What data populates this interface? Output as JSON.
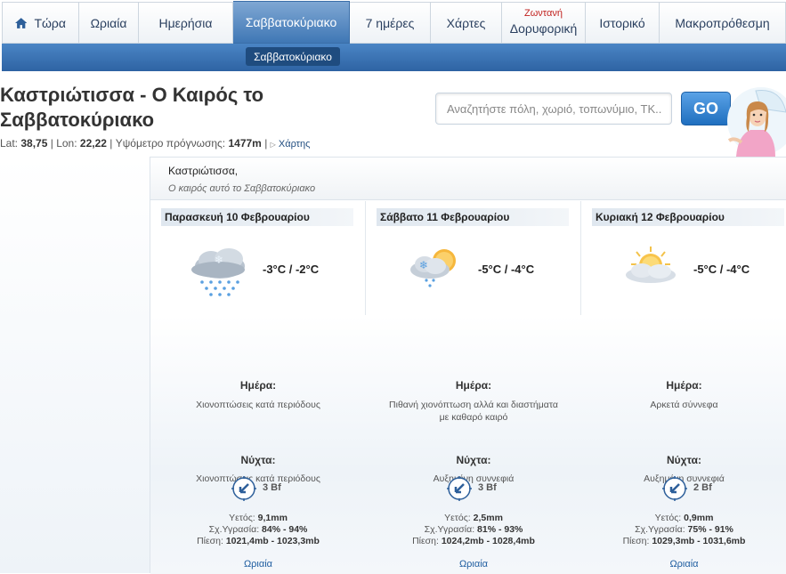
{
  "nav": {
    "tabs": [
      {
        "label": "Τώρα",
        "icon": "home-icon"
      },
      {
        "label": "Ωριαία"
      },
      {
        "label": "Ημερήσια"
      },
      {
        "label": "Σαββατοκύριακο",
        "active": true
      },
      {
        "label": "7 ημέρες"
      },
      {
        "label": "Χάρτες"
      },
      {
        "label": "Δορυφορική",
        "badge": "Ζωντανή"
      },
      {
        "label": "Ιστορικό"
      },
      {
        "label": "Μακροπρόθεσμη"
      }
    ],
    "subnav_active": "Σαββατοκύριακο"
  },
  "page": {
    "title": "Καστριώτισσα - Ο Καιρός το Σαββατοκύριακο",
    "lat_label": "Lat:",
    "lat": "38,75",
    "lon_label": "Lon:",
    "lon": "22,22",
    "elev_label": "Υψόμετρο πρόγνωσης:",
    "elev": "1477m",
    "map_link": "Χάρτης"
  },
  "search": {
    "placeholder": "Αναζητήστε πόλη, χωριό, τοπωνύμιο, ΤΚ..",
    "go_label": "GO"
  },
  "forecast": {
    "location": "Καστριώτισσα,",
    "subtitle": "Ο καιρός αυτό το Σαββατοκύριακο",
    "day_label": "Ημέρα:",
    "night_label": "Νύχτα:",
    "rain_label": "Υετός:",
    "humidity_label": "Σχ.Υγρασία:",
    "pressure_label": "Πίεση:",
    "hourly_link": "Ωριαία",
    "days": [
      {
        "title": "Παρασκευή 10 Φεβρουαρίου",
        "icon": "snow-cloud-icon",
        "temp": "-3°C / -2°C",
        "day_text": "Χιονοπτώσεις κατά περιόδους",
        "night_text": "Χιονοπτώσεις κατά περιόδους",
        "wind": "3 Bf",
        "rain": "9,1mm",
        "humidity": "84% - 94%",
        "pressure": "1021,4mb - 1023,3mb"
      },
      {
        "title": "Σάββατο 11 Φεβρουαρίου",
        "icon": "sun-snow-cloud-icon",
        "temp": "-5°C / -4°C",
        "day_text": "Πιθανή χιονόπτωση αλλά και διαστήματα με καθαρό καιρό",
        "night_text": "Αυξημένη συννεφιά",
        "wind": "3 Bf",
        "rain": "2,5mm",
        "humidity": "81% - 93%",
        "pressure": "1024,2mb - 1028,4mb"
      },
      {
        "title": "Κυριακή 12 Φεβρουαρίου",
        "icon": "sun-cloud-icon",
        "temp": "-5°C / -4°C",
        "day_text": "Αρκετά σύννεφα",
        "night_text": "Αυξημένη συννεφιά",
        "wind": "2 Bf",
        "rain": "0,9mm",
        "humidity": "75% - 91%",
        "pressure": "1029,3mb - 1031,6mb"
      }
    ]
  }
}
